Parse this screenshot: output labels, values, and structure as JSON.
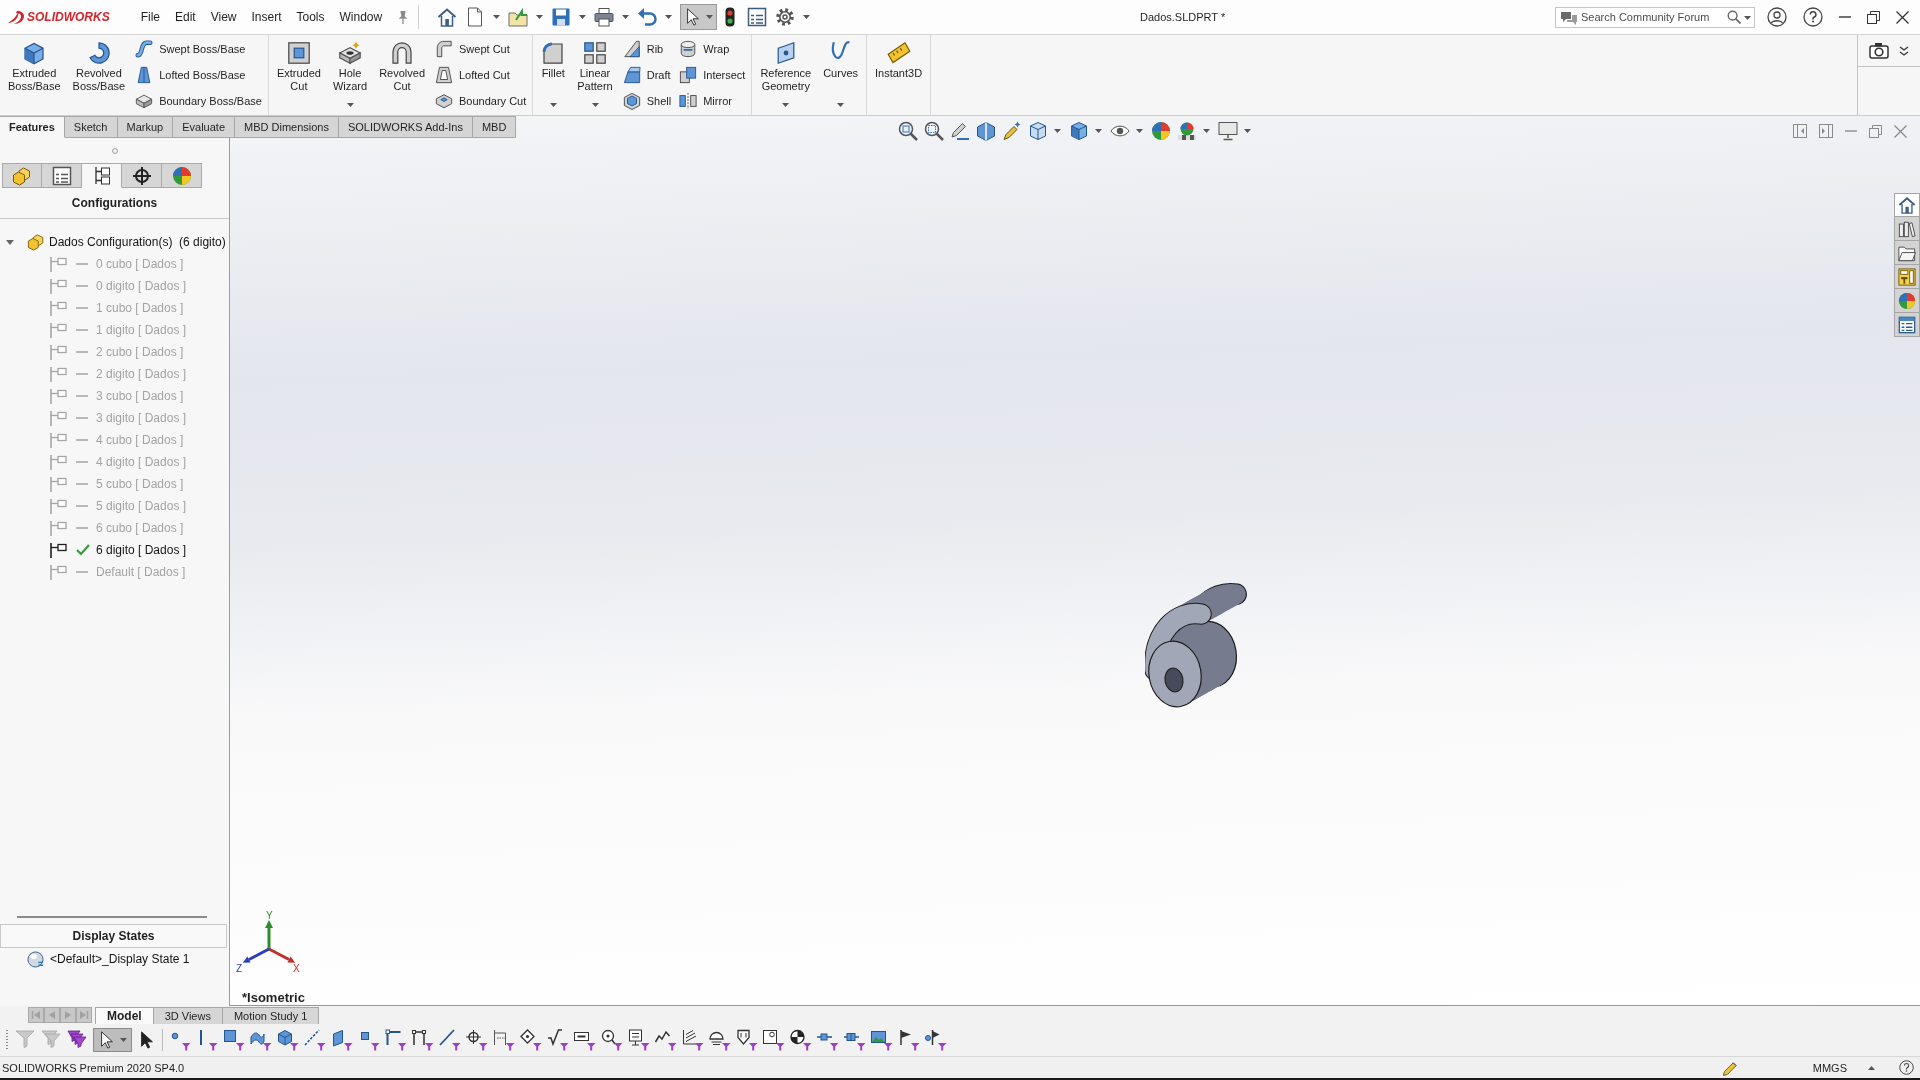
{
  "title_bar": {
    "logo": "SOLIDWORKS",
    "menus": [
      "File",
      "Edit",
      "View",
      "Insert",
      "Tools",
      "Window"
    ],
    "select_tool_active": true,
    "document_title": "Dados.SLDPRT *",
    "search": {
      "placeholder": "Search Community Forum"
    }
  },
  "ribbon": {
    "groups": [
      {
        "items": [
          {
            "kind": "large",
            "label": "Extruded Boss/Base",
            "dropdown": false
          },
          {
            "kind": "large",
            "label": "Revolved Boss/Base",
            "dropdown": false
          },
          {
            "kind": "stack",
            "items": [
              "Swept Boss/Base",
              "Lofted Boss/Base",
              "Boundary Boss/Base"
            ]
          }
        ]
      },
      {
        "items": [
          {
            "kind": "large",
            "label": "Extruded Cut",
            "dropdown": false
          },
          {
            "kind": "large",
            "label": "Hole Wizard",
            "dropdown": true
          },
          {
            "kind": "large",
            "label": "Revolved Cut",
            "dropdown": false
          },
          {
            "kind": "stack",
            "items": [
              "Swept Cut",
              "Lofted Cut",
              "Boundary Cut"
            ]
          }
        ]
      },
      {
        "items": [
          {
            "kind": "large",
            "label": "Fillet",
            "dropdown": true
          },
          {
            "kind": "large",
            "label": "Linear Pattern",
            "dropdown": true
          },
          {
            "kind": "stack",
            "items": [
              "Rib",
              "Draft",
              "Shell"
            ]
          },
          {
            "kind": "stack",
            "items": [
              "Wrap",
              "Intersect",
              "Mirror"
            ]
          }
        ]
      },
      {
        "items": [
          {
            "kind": "large",
            "label": "Reference Geometry",
            "dropdown": true
          },
          {
            "kind": "large",
            "label": "Curves",
            "dropdown": true
          }
        ]
      },
      {
        "items": [
          {
            "kind": "large",
            "label": "Instant3D",
            "dropdown": false
          }
        ]
      }
    ]
  },
  "command_tabs": [
    {
      "label": "Features",
      "selected": true
    },
    {
      "label": "Sketch",
      "selected": false
    },
    {
      "label": "Markup",
      "selected": false
    },
    {
      "label": "Evaluate",
      "selected": false
    },
    {
      "label": "MBD Dimensions",
      "selected": false
    },
    {
      "label": "SOLIDWORKS Add-Ins",
      "selected": false
    },
    {
      "label": "MBD",
      "selected": false
    }
  ],
  "feature_manager": {
    "tabs": [
      {
        "selected": false
      },
      {
        "selected": false
      },
      {
        "selected": true
      },
      {
        "selected": false
      },
      {
        "selected": false
      }
    ],
    "title": "Configurations",
    "tree": {
      "label": "Dados Configuration(s)  (6 digito)",
      "expanded": true,
      "children": [
        {
          "label": "0 cubo [ Dados ]",
          "active": false
        },
        {
          "label": "0 digito [ Dados ]",
          "active": false
        },
        {
          "label": "1 cubo [ Dados ]",
          "active": false
        },
        {
          "label": "1 digito [ Dados ]",
          "active": false
        },
        {
          "label": "2 cubo [ Dados ]",
          "active": false
        },
        {
          "label": "2 digito [ Dados ]",
          "active": false
        },
        {
          "label": "3 cubo [ Dados ]",
          "active": false
        },
        {
          "label": "3 digito [ Dados ]",
          "active": false
        },
        {
          "label": "4 cubo [ Dados ]",
          "active": false
        },
        {
          "label": "4 digito [ Dados ]",
          "active": false
        },
        {
          "label": "5 cubo [ Dados ]",
          "active": false
        },
        {
          "label": "5 digito [ Dados ]",
          "active": false
        },
        {
          "label": "6 cubo [ Dados ]",
          "active": false
        },
        {
          "label": "6 digito [ Dados ]",
          "active": true
        },
        {
          "label": "Default [ Dados ]",
          "active": false
        }
      ]
    },
    "display_states": {
      "title": "Display States",
      "items": [
        {
          "label": "<Default>_Display State 1"
        }
      ]
    }
  },
  "viewport": {
    "triad": {
      "x": "X",
      "y": "Y",
      "z": "Z"
    },
    "view_name": "*Isometric"
  },
  "task_pane": [
    {
      "selected": true
    },
    {
      "selected": false
    },
    {
      "selected": false
    },
    {
      "selected": false
    },
    {
      "selected": false
    },
    {
      "selected": false
    }
  ],
  "bottom_tabs": {
    "scroll_disabled": true,
    "tabs": [
      {
        "label": "Model",
        "selected": true
      },
      {
        "label": "3D Views",
        "selected": false
      },
      {
        "label": "Motion Study 1",
        "selected": false
      }
    ]
  },
  "selection_toolbar": {
    "filters": [
      {
        "disabled": true
      },
      {
        "disabled": true
      },
      {
        "disabled": false
      }
    ],
    "select_active": true
  },
  "status_bar": {
    "product": "SOLIDWORKS Premium 2020 SP4.0",
    "units": "MMGS"
  }
}
